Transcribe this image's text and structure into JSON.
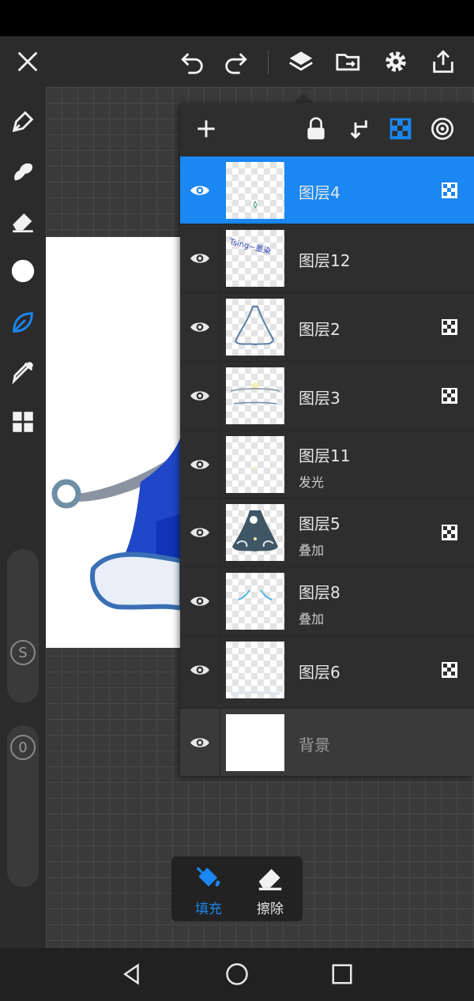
{
  "colors": {
    "accent": "#1a87f2",
    "panel_bg": "#2e2e2e",
    "icon_white": "#f2f2f2",
    "canvas_bg": "#3a3a3a"
  },
  "top_toolbar": {
    "icons": [
      "close-icon",
      "undo-icon",
      "redo-icon",
      "layers-icon",
      "folder-transfer-icon",
      "gear-icon",
      "share-icon"
    ]
  },
  "left_toolbar": {
    "tools": [
      "pen-icon",
      "smudge-icon",
      "eraser-icon",
      "color-swatch",
      "leaf-brush-icon",
      "eyedropper-icon",
      "grid-menu-icon"
    ],
    "active_tool": "leaf-brush-icon",
    "size_slider_label": "S",
    "opacity_slider_label": "0"
  },
  "layer_panel": {
    "header_icons": [
      "add-layer-icon",
      "lock-icon",
      "clip-down-icon",
      "alpha-lock-icon",
      "blend-target-icon"
    ],
    "layers": [
      {
        "name": "图层4",
        "mode": "",
        "selected": true,
        "alpha_locked": true
      },
      {
        "name": "图层12",
        "mode": "",
        "selected": false,
        "alpha_locked": false
      },
      {
        "name": "图层2",
        "mode": "",
        "selected": false,
        "alpha_locked": true
      },
      {
        "name": "图层3",
        "mode": "",
        "selected": false,
        "alpha_locked": true
      },
      {
        "name": "图层11",
        "mode": "发光",
        "selected": false,
        "alpha_locked": false
      },
      {
        "name": "图层5",
        "mode": "叠加",
        "selected": false,
        "alpha_locked": true
      },
      {
        "name": "图层8",
        "mode": "叠加",
        "selected": false,
        "alpha_locked": false
      },
      {
        "name": "图层6",
        "mode": "",
        "selected": false,
        "alpha_locked": true
      },
      {
        "name": "背景",
        "mode": "",
        "selected": false,
        "alpha_locked": false
      }
    ],
    "thumb12_text": "Tsing~墨染"
  },
  "bottom_tools": {
    "fill_label": "填充",
    "erase_label": "擦除"
  },
  "nav_bar": {
    "icons": [
      "back-icon",
      "home-icon",
      "recents-icon"
    ]
  }
}
